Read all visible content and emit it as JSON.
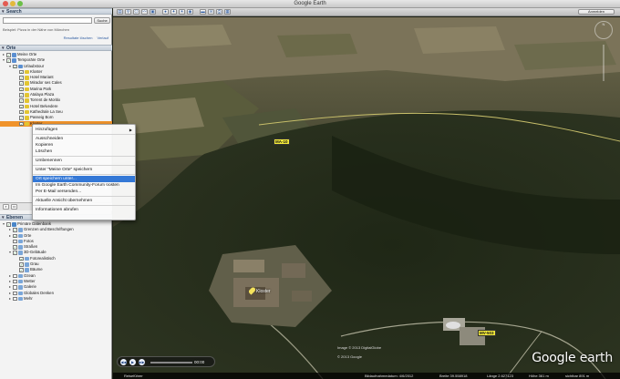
{
  "window": {
    "title": "Google Earth"
  },
  "search": {
    "header": "Search",
    "placeholder": "",
    "button": "Suche",
    "hint": "Beispiel: Pizza in der Nähe von München",
    "link_clear": "Resultate löschen",
    "link_history": "Verlauf"
  },
  "places": {
    "header": "Orte",
    "items": [
      {
        "label": "Meine Orte",
        "level": 0,
        "arrow": "▸",
        "checked": true,
        "icon": "folder-icon"
      },
      {
        "label": "Temporäre Orte",
        "level": 0,
        "arrow": "▾",
        "checked": true,
        "icon": "folder-icon"
      },
      {
        "label": "Urlaubstour",
        "level": 1,
        "arrow": "▾",
        "checked": true,
        "icon": "folder-icon"
      },
      {
        "label": "Kloster",
        "level": 2,
        "arrow": "",
        "checked": true,
        "icon": "pin-icon"
      },
      {
        "label": "Hotel Mariant",
        "level": 2,
        "arrow": "",
        "checked": true,
        "icon": "pin-icon"
      },
      {
        "label": "Mirador ses Cales",
        "level": 2,
        "arrow": "",
        "checked": true,
        "icon": "pin-icon"
      },
      {
        "label": "Marina Park",
        "level": 2,
        "arrow": "",
        "checked": true,
        "icon": "pin-icon"
      },
      {
        "label": "Atalaya Plaza",
        "level": 2,
        "arrow": "",
        "checked": true,
        "icon": "pin-icon"
      },
      {
        "label": "Torrent de Moritix",
        "level": 2,
        "arrow": "",
        "checked": true,
        "icon": "pin-icon"
      },
      {
        "label": "Hotel Belvedere",
        "level": 2,
        "arrow": "",
        "checked": true,
        "icon": "pin-icon"
      },
      {
        "label": "Kathedrale La Seu",
        "level": 2,
        "arrow": "",
        "checked": true,
        "icon": "pin-icon"
      },
      {
        "label": "Passeig Born",
        "level": 2,
        "arrow": "",
        "checked": true,
        "icon": "pin-icon"
      },
      {
        "label": "Kloster",
        "level": 2,
        "arrow": "",
        "checked": true,
        "icon": "pin-icon",
        "selected": true
      }
    ]
  },
  "context_menu": {
    "items": [
      {
        "label": "Hinzufügen",
        "submenu": true
      },
      {
        "sep": true
      },
      {
        "label": "Ausschneiden"
      },
      {
        "label": "Kopieren"
      },
      {
        "label": "Löschen"
      },
      {
        "sep": true
      },
      {
        "label": "Umbenennen"
      },
      {
        "sep": true
      },
      {
        "label": "Unter \"Meine Orte\" speichern"
      },
      {
        "sep": true
      },
      {
        "label": "Ort speichern unter...",
        "highlight": true
      },
      {
        "label": "Im Google Earth Community-Forum posten"
      },
      {
        "label": "Per E-Mail versenden..."
      },
      {
        "sep": true
      },
      {
        "label": "Aktuelle Ansicht übernehmen"
      },
      {
        "sep": true
      },
      {
        "label": "Informationen abrufen"
      }
    ]
  },
  "layers": {
    "header": "Ebenen",
    "items": [
      {
        "label": "Primäre Datenbank",
        "level": 0,
        "arrow": "▾",
        "checked": true,
        "icon": "globe-icon"
      },
      {
        "label": "Grenzen und Beschriftungen",
        "level": 1,
        "arrow": "▸",
        "checked": true,
        "icon": "layer-icon"
      },
      {
        "label": "Orte",
        "level": 1,
        "arrow": "▸",
        "checked": true,
        "icon": "layer-icon"
      },
      {
        "label": "Fotos",
        "level": 1,
        "arrow": "",
        "checked": false,
        "icon": "layer-icon"
      },
      {
        "label": "Straßen",
        "level": 1,
        "arrow": "",
        "checked": true,
        "icon": "layer-icon"
      },
      {
        "label": "3D-Gebäude",
        "level": 1,
        "arrow": "▾",
        "checked": true,
        "icon": "layer-icon"
      },
      {
        "label": "Fotorealistisch",
        "level": 2,
        "arrow": "",
        "checked": true,
        "icon": "layer-icon"
      },
      {
        "label": "Grau",
        "level": 2,
        "arrow": "",
        "checked": true,
        "icon": "layer-icon"
      },
      {
        "label": "Bäume",
        "level": 2,
        "arrow": "",
        "checked": true,
        "icon": "layer-icon"
      },
      {
        "label": "Ozean",
        "level": 1,
        "arrow": "▸",
        "checked": false,
        "icon": "layer-icon"
      },
      {
        "label": "Wetter",
        "level": 1,
        "arrow": "▸",
        "checked": false,
        "icon": "layer-icon"
      },
      {
        "label": "Galerie",
        "level": 1,
        "arrow": "▸",
        "checked": false,
        "icon": "layer-icon"
      },
      {
        "label": "Globales Denken",
        "level": 1,
        "arrow": "▸",
        "checked": false,
        "icon": "layer-icon"
      },
      {
        "label": "Mehr",
        "level": 1,
        "arrow": "▸",
        "checked": false,
        "icon": "layer-icon"
      }
    ]
  },
  "toolbar": {
    "buttons": [
      "sidebar-icon",
      "placemark-icon",
      "polygon-icon",
      "path-icon",
      "overlay-icon",
      "tour-icon",
      "sky-icon",
      "sun-icon",
      "planet-icon",
      "ruler-icon",
      "email-icon",
      "print-icon",
      "map-icon"
    ],
    "login": "Anmelden"
  },
  "map": {
    "compass_n": "N",
    "place_label": "Kloster",
    "road_sign_1": "MA-10",
    "road_sign_2": "MV-503",
    "copyright_1": "Image © 2013 DigitalGlobe",
    "copyright_2": "© 2013 Google",
    "logo_google": "Google",
    "logo_earth": "earth",
    "timeline_time": "00:00",
    "status": {
      "tour": "Reiseführer",
      "imagery_date": "Bildaufnahmedatum: 4/6/2012",
      "lat": "Breite 39.558918",
      "lon": "Länge 2.627123",
      "elev": "Höhe 361 m",
      "eye": "sichtbar 891 m"
    }
  }
}
